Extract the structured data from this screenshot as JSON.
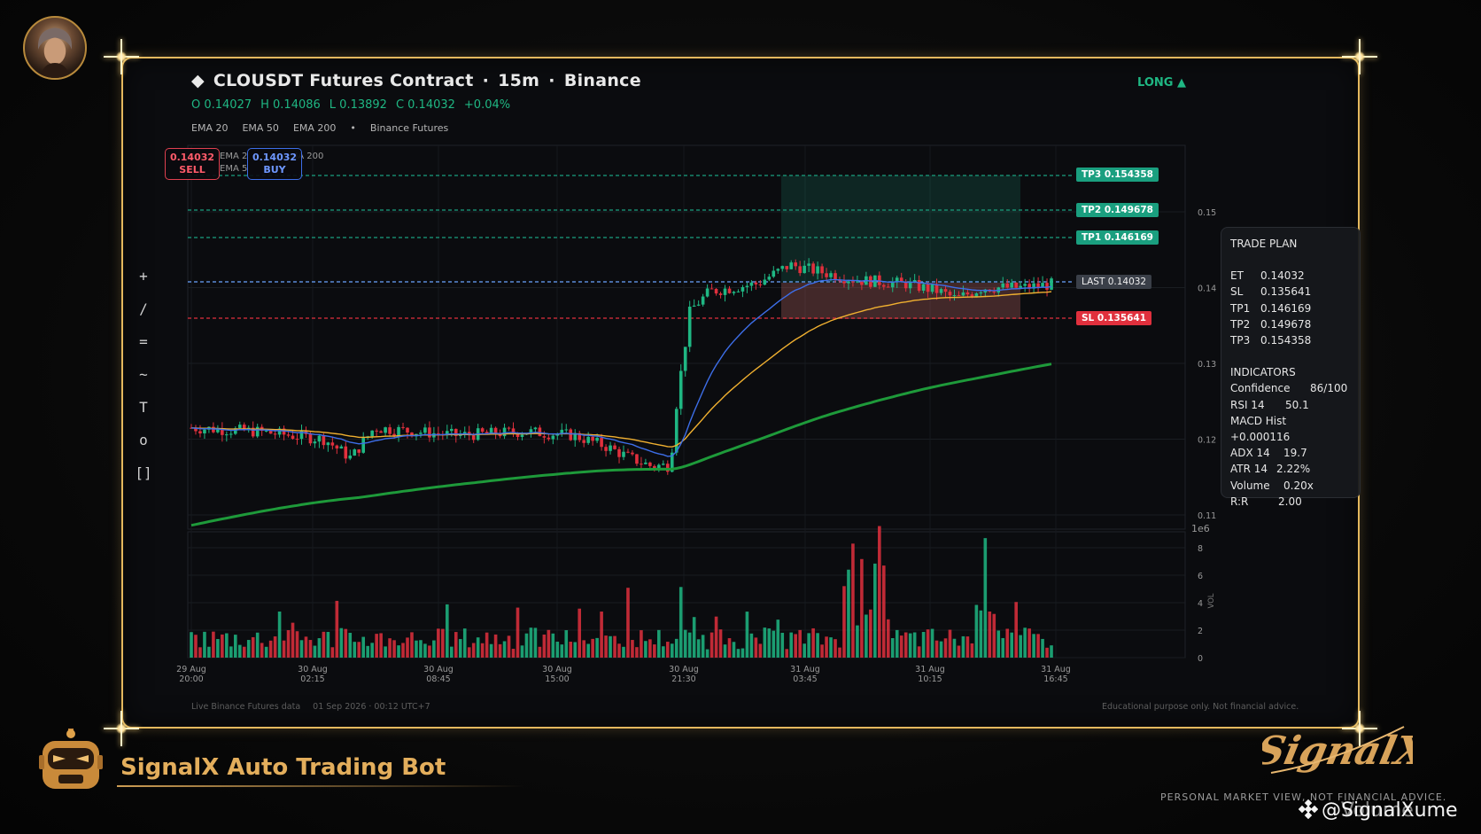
{
  "header": {
    "symbol": "CLOUSDT Futures Contract",
    "timeframe": "15m",
    "exchange": "Binance",
    "separator": "·",
    "ohlc": {
      "open": "O 0.14027",
      "high": "H 0.14086",
      "low": "L 0.13892",
      "close": "C 0.14032",
      "change": "+0.04%"
    },
    "legend": [
      "EMA 20",
      "EMA 50",
      "EMA 200",
      "•",
      "Binance Futures"
    ],
    "direction": "LONG ▲"
  },
  "toolbar": [
    "+",
    "/",
    "=",
    "~",
    "T",
    "o",
    "[]"
  ],
  "order_buttons": {
    "sell_price": "0.14032",
    "sell_label": "SELL",
    "buy_price": "0.14032",
    "buy_label": "BUY"
  },
  "ghost_legend": {
    "line1": "EMA 2",
    "line1b": "IA 200",
    "line2": "EMA 5"
  },
  "levels": {
    "tp3": "TP3  0.154358",
    "tp2": "TP2  0.149678",
    "tp1": "TP1  0.146169",
    "last": "LAST  0.14032",
    "sl": "SL  0.135641"
  },
  "price_axis": [
    "0.15",
    "0.14",
    "0.13",
    "0.12",
    "0.11"
  ],
  "price_axis_unit": "1e6",
  "volume_axis": [
    "8",
    "6",
    "4",
    "2",
    "0"
  ],
  "volume_axis_label": "VOL",
  "time_axis": [
    [
      "29 Aug",
      "20:00"
    ],
    [
      "30 Aug",
      "02:15"
    ],
    [
      "30 Aug",
      "08:45"
    ],
    [
      "30 Aug",
      "15:00"
    ],
    [
      "30 Aug",
      "21:30"
    ],
    [
      "31 Aug",
      "03:45"
    ],
    [
      "31 Aug",
      "10:15"
    ],
    [
      "31 Aug",
      "16:45"
    ]
  ],
  "trade_plan": {
    "title": "TRADE PLAN",
    "rows": [
      [
        "ET",
        "0.14032"
      ],
      [
        "SL",
        "0.135641"
      ],
      [
        "TP1",
        "0.146169"
      ],
      [
        "TP2",
        "0.149678"
      ],
      [
        "TP3",
        "0.154358"
      ]
    ],
    "indicators_title": "INDICATORS",
    "indicators": [
      [
        "Confidence",
        "86/100"
      ],
      [
        "RSI 14",
        "50.1"
      ],
      [
        "MACD Hist",
        "+0.000116"
      ],
      [
        "ADX 14",
        "19.7"
      ],
      [
        "ATR 14",
        "2.22%"
      ],
      [
        "Volume",
        "0.20x"
      ],
      [
        "R:R",
        "2.00"
      ]
    ]
  },
  "footer": {
    "source": "Live Binance Futures data",
    "timestamp": "01 Sep 2026 · 00:12 UTC+7",
    "disclaimer": "Educational purpose only. Not financial advice."
  },
  "brand": {
    "name": "SignalX Auto Trading Bot",
    "logo_text": "SignalX",
    "tagline": "PERSONAL MARKET VIEW, NOT FINANCIAL ADVICE.",
    "watermark": "@SignalXume",
    "watermark_overlay": "@Volume"
  },
  "colors": {
    "frame": "#e4b85e",
    "up": "#1fb783",
    "down": "#e0303d",
    "ema20": "#3d6ee8",
    "ema50": "#f0b030",
    "ema200": "#1e9a3a",
    "tp": "#1a9f7f",
    "sl": "#e0303d"
  }
}
